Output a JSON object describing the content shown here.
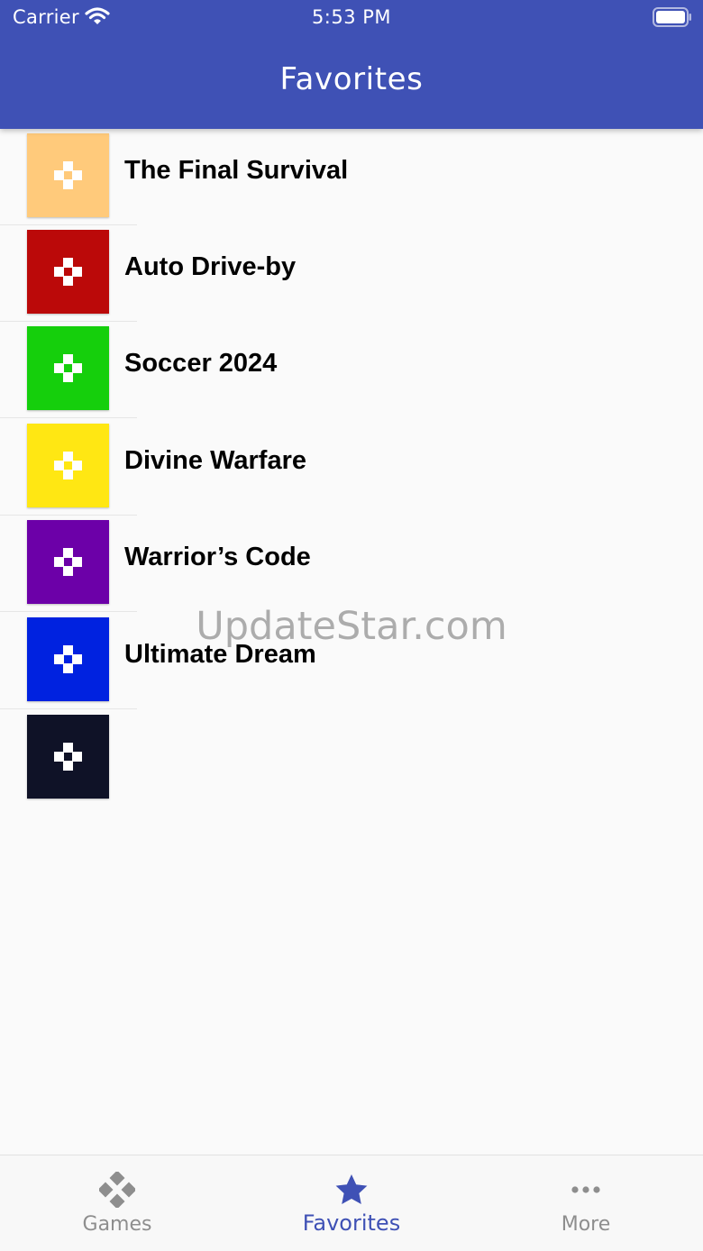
{
  "status_bar": {
    "carrier": "Carrier",
    "time": "5:53 PM",
    "wifi_icon": "wifi-icon",
    "battery_icon": "battery-icon"
  },
  "header": {
    "title": "Favorites",
    "background": "#3f51b5"
  },
  "favorites": [
    {
      "label": "The Final Survival",
      "color": "#ffca7b",
      "icon": "gamepad-icon"
    },
    {
      "label": "Auto Drive-by",
      "color": "#bb0909",
      "icon": "gamepad-icon"
    },
    {
      "label": "Soccer 2024",
      "color": "#15cf0c",
      "icon": "gamepad-icon"
    },
    {
      "label": "Divine Warfare",
      "color": "#ffe713",
      "icon": "gamepad-icon"
    },
    {
      "label": "Warrior’s Code",
      "color": "#6c00a8",
      "icon": "gamepad-icon"
    },
    {
      "label": "Ultimate Dream",
      "color": "#0022e0",
      "icon": "gamepad-icon"
    },
    {
      "label": "",
      "color": "#0f1227",
      "icon": "gamepad-icon"
    }
  ],
  "watermark": "UpdateStar.com",
  "tab_bar": {
    "tabs": [
      {
        "label": "Games",
        "icon": "gamepad-icon",
        "active": false
      },
      {
        "label": "Favorites",
        "icon": "star-icon",
        "active": true
      },
      {
        "label": "More",
        "icon": "more-icon",
        "active": false
      }
    ],
    "active_color": "#3f51b5",
    "inactive_color": "#8e8e8e"
  }
}
